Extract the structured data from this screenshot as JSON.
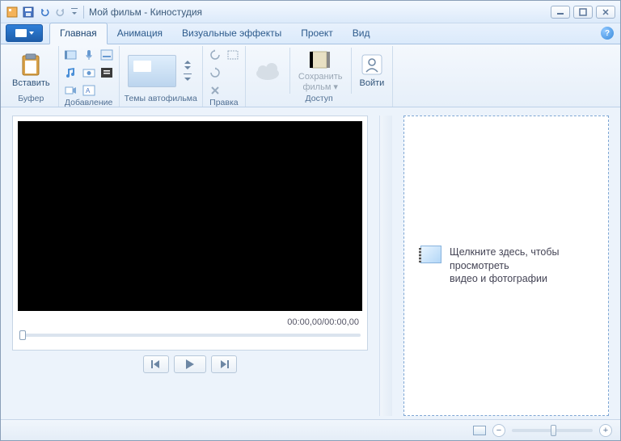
{
  "titlebar": {
    "title": "Мой фильм - Киностудия"
  },
  "tabs": {
    "main": "Главная",
    "animation": "Анимация",
    "effects": "Визуальные эффекты",
    "project": "Проект",
    "view": "Вид"
  },
  "ribbon": {
    "clipboard": {
      "paste": "Вставить",
      "group": "Буфер"
    },
    "add": {
      "group": "Добавление"
    },
    "themes": {
      "group": "Темы автофильма"
    },
    "edit": {
      "group": "Правка"
    },
    "access": {
      "group": "Доступ",
      "save_movie_line1": "Сохранить",
      "save_movie_line2": "фильм ▾",
      "login": "Войти"
    }
  },
  "preview": {
    "timecode": "00:00,00/00:00,00"
  },
  "storyboard": {
    "hint_line1": "Щелкните здесь, чтобы просмотреть",
    "hint_line2": "видео и фотографии"
  },
  "status": {
    "minus": "−",
    "plus": "+"
  }
}
